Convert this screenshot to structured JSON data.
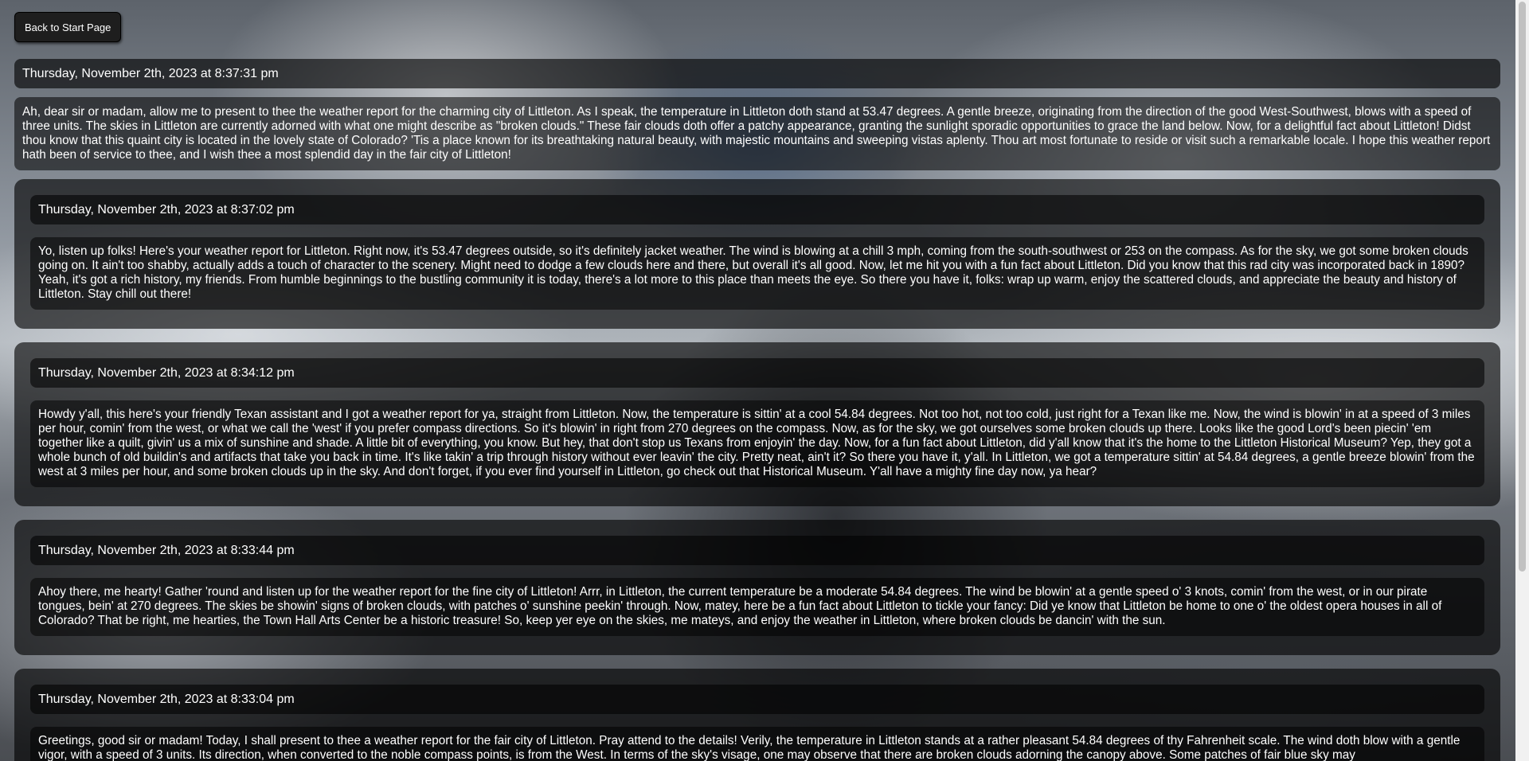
{
  "nav": {
    "back_label": "Back to Start Page"
  },
  "latest": {
    "date": "Thursday, November 2th, 2023 at 8:37:31 pm",
    "text": "Ah, dear sir or madam, allow me to present to thee the weather report for the charming city of Littleton. As I speak, the temperature in Littleton doth stand at 53.47 degrees. A gentle breeze, originating from the direction of the good West-Southwest, blows with a speed of three units. The skies in Littleton are currently adorned with what one might describe as \"broken clouds.\" These fair clouds doth offer a patchy appearance, granting the sunlight sporadic opportunities to grace the land below. Now, for a delightful fact about Littleton! Didst thou know that this quaint city is located in the lovely state of Colorado? 'Tis a place known for its breathtaking natural beauty, with majestic mountains and sweeping vistas aplenty. Thou art most fortunate to reside or visit such a remarkable locale. I hope this weather report hath been of service to thee, and I wish thee a most splendid day in the fair city of Littleton!"
  },
  "history": [
    {
      "date": "Thursday, November 2th, 2023 at 8:37:02 pm",
      "text": "Yo, listen up folks! Here's your weather report for Littleton. Right now, it's 53.47 degrees outside, so it's definitely jacket weather. The wind is blowing at a chill 3 mph, coming from the south-southwest or 253 on the compass. As for the sky, we got some broken clouds going on. It ain't too shabby, actually adds a touch of character to the scenery. Might need to dodge a few clouds here and there, but overall it's all good. Now, let me hit you with a fun fact about Littleton. Did you know that this rad city was incorporated back in 1890? Yeah, it's got a rich history, my friends. From humble beginnings to the bustling community it is today, there's a lot more to this place than meets the eye. So there you have it, folks: wrap up warm, enjoy the scattered clouds, and appreciate the beauty and history of Littleton. Stay chill out there!"
    },
    {
      "date": "Thursday, November 2th, 2023 at 8:34:12 pm",
      "text": "Howdy y'all, this here's your friendly Texan assistant and I got a weather report for ya, straight from Littleton. Now, the temperature is sittin' at a cool 54.84 degrees. Not too hot, not too cold, just right for a Texan like me. Now, the wind is blowin' in at a speed of 3 miles per hour, comin' from the west, or what we call the 'west' if you prefer compass directions. So it's blowin' in right from 270 degrees on the compass. Now, as for the sky, we got ourselves some broken clouds up there. Looks like the good Lord's been piecin' 'em together like a quilt, givin' us a mix of sunshine and shade. A little bit of everything, you know. But hey, that don't stop us Texans from enjoyin' the day. Now, for a fun fact about Littleton, did y'all know that it's the home to the Littleton Historical Museum? Yep, they got a whole bunch of old buildin's and artifacts that take you back in time. It's like takin' a trip through history without ever leavin' the city. Pretty neat, ain't it? So there you have it, y'all. In Littleton, we got a temperature sittin' at 54.84 degrees, a gentle breeze blowin' from the west at 3 miles per hour, and some broken clouds up in the sky. And don't forget, if you ever find yourself in Littleton, go check out that Historical Museum. Y'all have a mighty fine day now, ya hear?"
    },
    {
      "date": "Thursday, November 2th, 2023 at 8:33:44 pm",
      "text": "Ahoy there, me hearty! Gather 'round and listen up for the weather report for the fine city of Littleton! Arrr, in Littleton, the current temperature be a moderate 54.84 degrees. The wind be blowin' at a gentle speed o' 3 knots, comin' from the west, or in our pirate tongues, bein' at 270 degrees. The skies be showin' signs of broken clouds, with patches o' sunshine peekin' through. Now, matey, here be a fun fact about Littleton to tickle your fancy: Did ye know that Littleton be home to one o' the oldest opera houses in all of Colorado? That be right, me hearties, the Town Hall Arts Center be a historic treasure! So, keep yer eye on the skies, me mateys, and enjoy the weather in Littleton, where broken clouds be dancin' with the sun."
    },
    {
      "date": "Thursday, November 2th, 2023 at 8:33:04 pm",
      "text": "Greetings, good sir or madam! Today, I shall present to thee a weather report for the fair city of Littleton. Pray attend to the details! Verily, the temperature in Littleton stands at a rather pleasant 54.84 degrees of thy Fahrenheit scale. The wind doth blow with a gentle vigor, with a speed of 3 units. Its direction, when converted to the noble compass points, is from the West. In terms of the sky's visage, one may observe that there are broken clouds adorning the canopy above. Some patches of fair blue sky may"
    }
  ]
}
